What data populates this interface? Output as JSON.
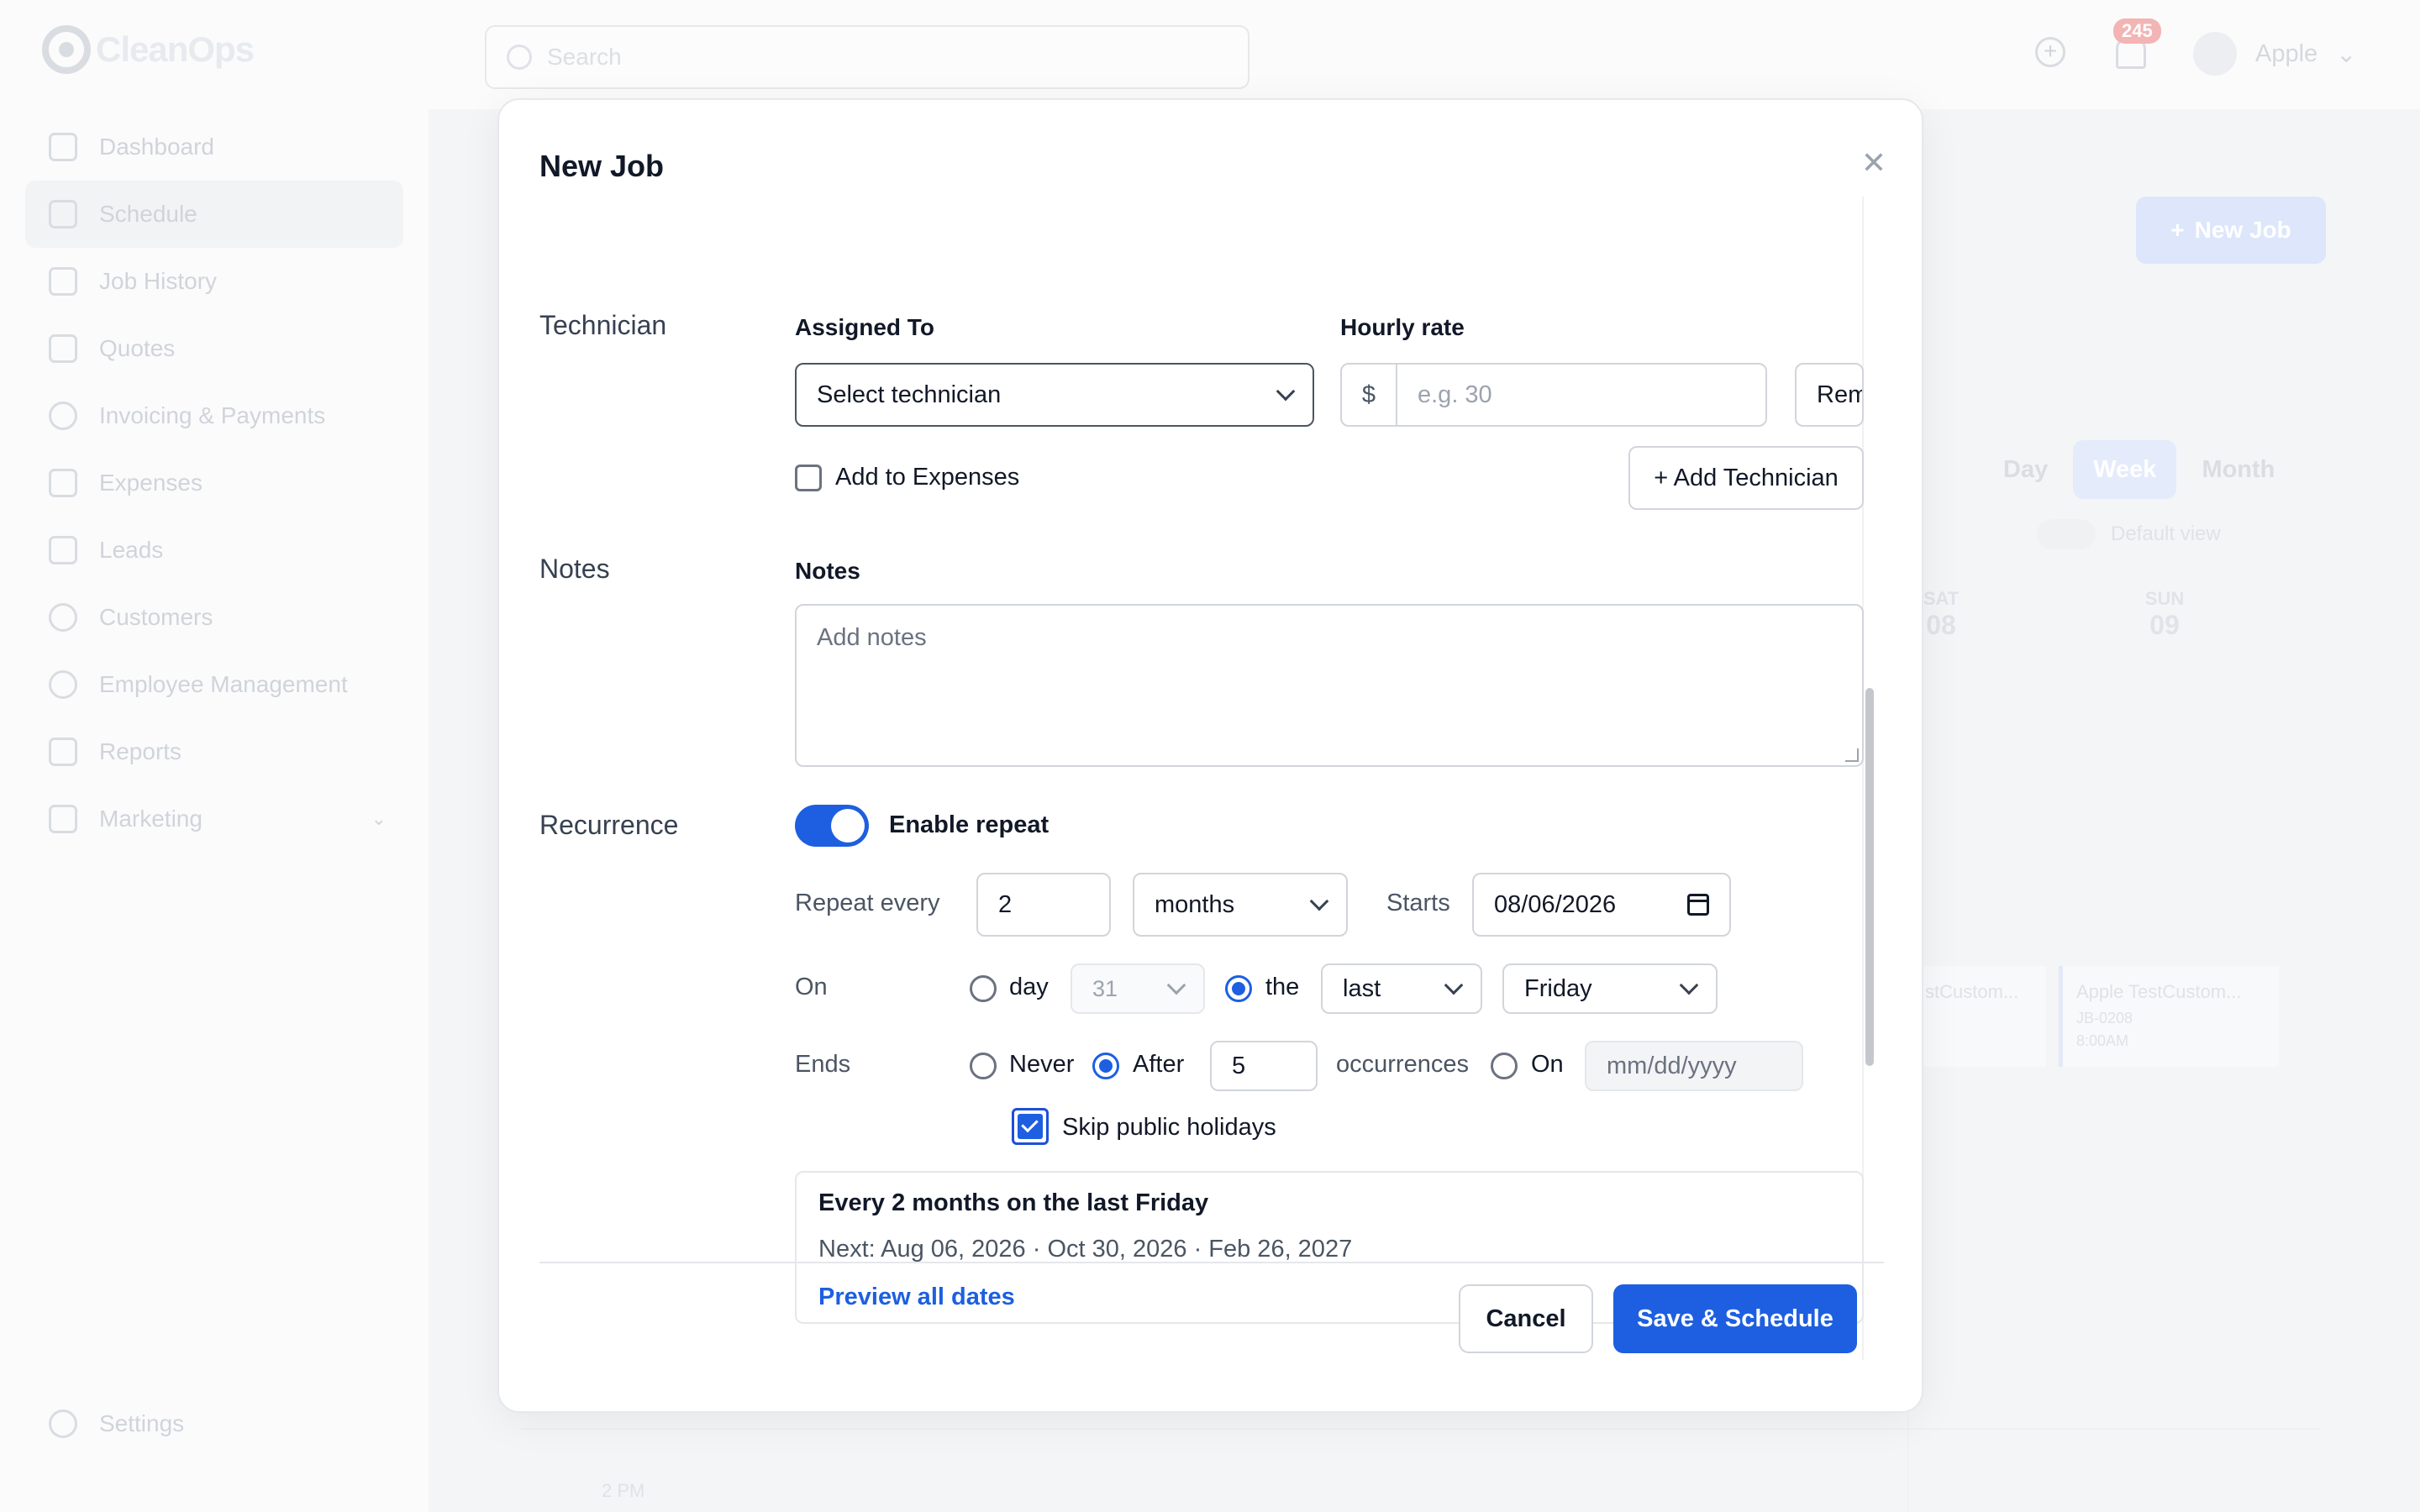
{
  "app": {
    "logo_a": "Clean",
    "logo_b": "Ops",
    "search_placeholder": "Search",
    "notifications_count": "245",
    "user_name": "Apple"
  },
  "sidebar": {
    "items": [
      {
        "label": "Dashboard",
        "icon": "home-icon"
      },
      {
        "label": "Schedule",
        "icon": "calendar-icon"
      },
      {
        "label": "Job History",
        "icon": "list-icon"
      },
      {
        "label": "Quotes",
        "icon": "document-icon"
      },
      {
        "label": "Invoicing & Payments",
        "icon": "dollar-icon"
      },
      {
        "label": "Expenses",
        "icon": "wallet-icon"
      },
      {
        "label": "Leads",
        "icon": "funnel-icon"
      },
      {
        "label": "Customers",
        "icon": "users-icon"
      },
      {
        "label": "Employee Management",
        "icon": "user-gear-icon"
      },
      {
        "label": "Reports",
        "icon": "chart-icon"
      },
      {
        "label": "Marketing",
        "icon": "megaphone-icon"
      }
    ],
    "settings": "Settings"
  },
  "background": {
    "new_job": "New Job",
    "views": [
      "Day",
      "Week",
      "Month"
    ],
    "default_view": "Default view",
    "day_sat_name": "SAT",
    "day_sat_num": "08",
    "day_sun_name": "SUN",
    "day_sun_num": "09",
    "event_title": "Apple TestCustom...",
    "event_id": "JB-0208",
    "event_time": "8:00AM",
    "event2_title": "stCustom...",
    "time_2pm": "2 PM"
  },
  "modal": {
    "title": "New Job",
    "technician": {
      "section": "Technician",
      "assigned_label": "Assigned To",
      "assigned_value": "Select technician",
      "rate_label": "Hourly rate",
      "currency": "$",
      "rate_placeholder": "e.g. 30",
      "remove_label": "Rem",
      "expenses_label": "Add to Expenses",
      "add_technician": "+ Add Technician"
    },
    "notes": {
      "section": "Notes",
      "label": "Notes",
      "placeholder": "Add notes"
    },
    "recurrence": {
      "section": "Recurrence",
      "enable_label": "Enable repeat",
      "enabled": true,
      "repeat_every_label": "Repeat every",
      "repeat_interval": "2",
      "repeat_unit": "months",
      "starts_label": "Starts",
      "starts_value": "08/06/2026",
      "on_label": "On",
      "on_day_label": "day",
      "on_day_value": "31",
      "on_the_label": "the",
      "on_ordinal": "last",
      "on_weekday": "Friday",
      "ends_label": "Ends",
      "ends_never": "Never",
      "ends_after": "After",
      "ends_after_value": "5",
      "occurrences_label": "occurrences",
      "ends_on": "On",
      "ends_on_placeholder": "mm/dd/yyyy",
      "skip_holidays": "Skip public holidays",
      "summary_title": "Every 2 months on the last Friday",
      "summary_next": "Next: Aug 06, 2026 · Oct 30, 2026 · Feb 26, 2027",
      "preview_link": "Preview all dates"
    },
    "cancel": "Cancel",
    "save": "Save & Schedule"
  },
  "colors": {
    "accent": "#1d5fe0",
    "text": "#111827",
    "border": "#d1d5db"
  }
}
